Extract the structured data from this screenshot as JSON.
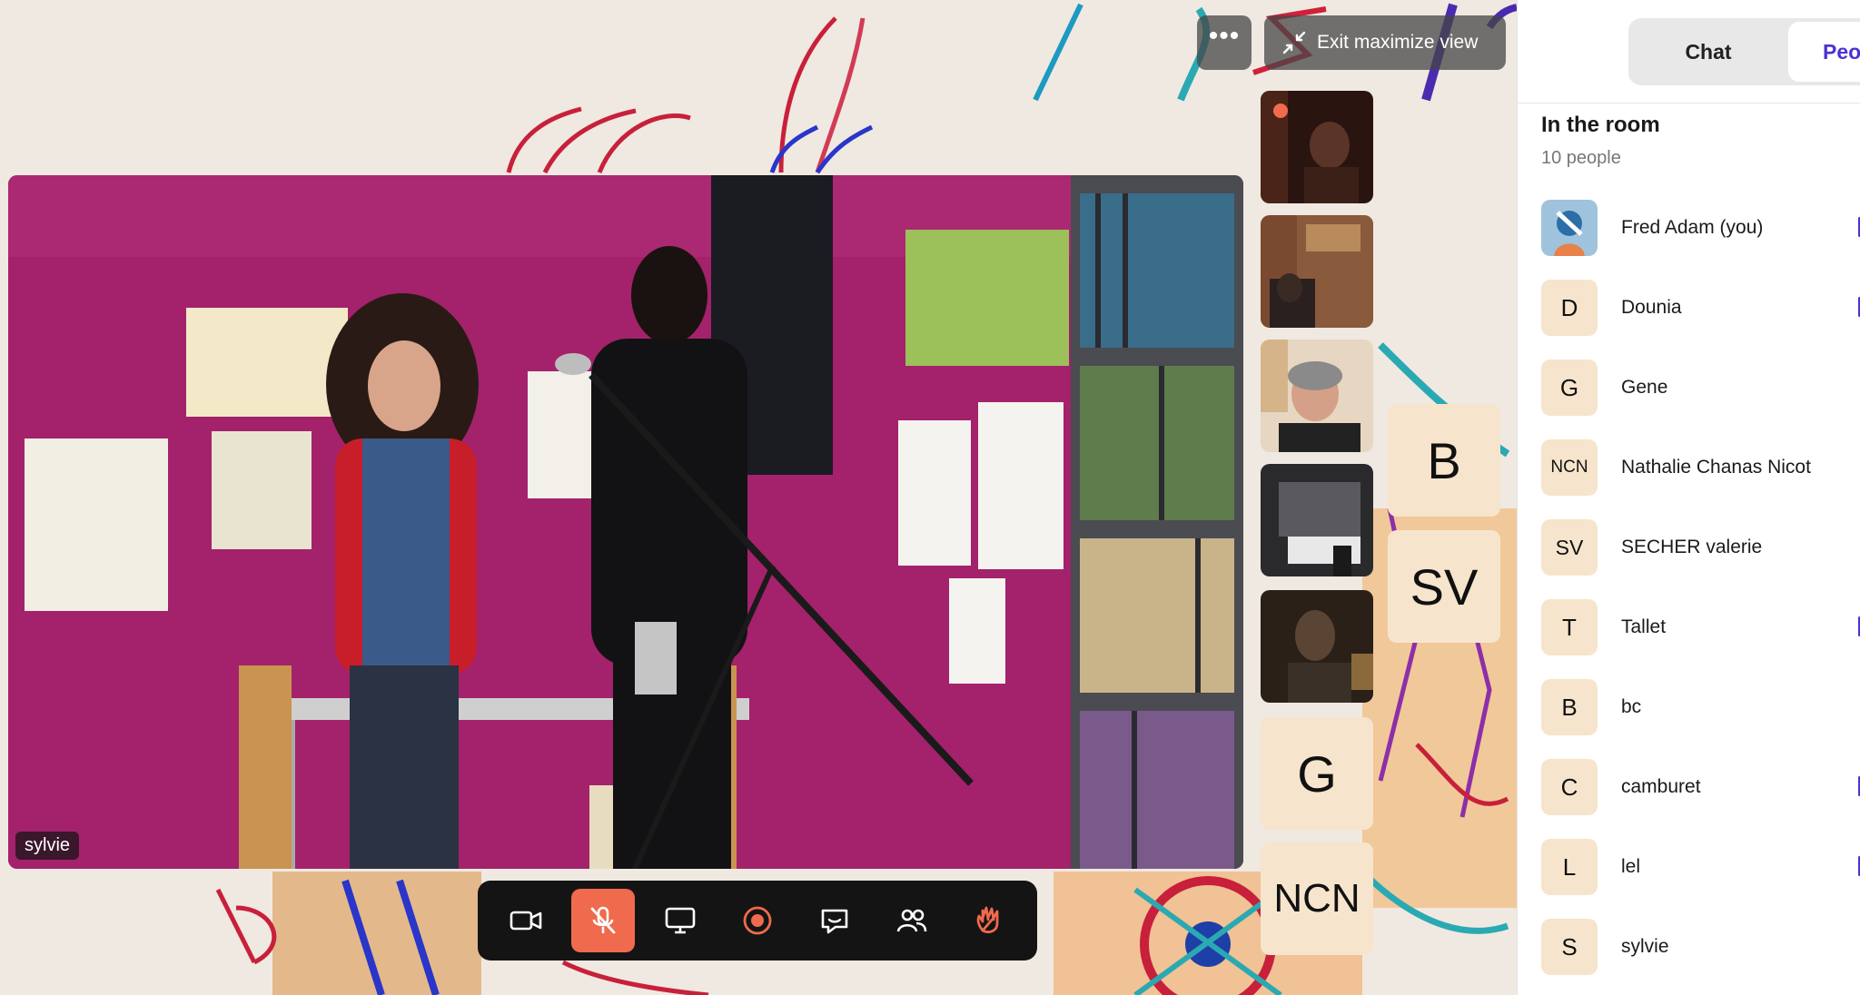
{
  "stage": {
    "more_button": "•••",
    "exit_maximize_label": "Exit maximize view",
    "speaker_name": "sylvie",
    "tiles_initials": [
      "B",
      "SV",
      "G",
      "NCN"
    ]
  },
  "toolbar": {
    "buttons": [
      "camera",
      "microphone-muted",
      "screen-share",
      "record",
      "chat",
      "people",
      "raise-hand"
    ]
  },
  "sidebar": {
    "tabs": {
      "chat": "Chat",
      "people": "Peo"
    },
    "room_heading": "In the room",
    "room_count": "10 people",
    "people": [
      {
        "initials": "",
        "name": "Fred Adam (you)"
      },
      {
        "initials": "D",
        "name": "Dounia"
      },
      {
        "initials": "G",
        "name": "Gene"
      },
      {
        "initials": "NCN",
        "name": "Nathalie Chanas Nicot"
      },
      {
        "initials": "SV",
        "name": "SECHER valerie"
      },
      {
        "initials": "T",
        "name": "Tallet"
      },
      {
        "initials": "B",
        "name": "bc"
      },
      {
        "initials": "C",
        "name": "camburet"
      },
      {
        "initials": "L",
        "name": "lel"
      },
      {
        "initials": "S",
        "name": "sylvie"
      }
    ]
  },
  "colors": {
    "accent": "#4a32d6",
    "muted_button": "#f06a4d",
    "initial_tile": "#f6e5cc",
    "video_wall": "#a3226b"
  }
}
